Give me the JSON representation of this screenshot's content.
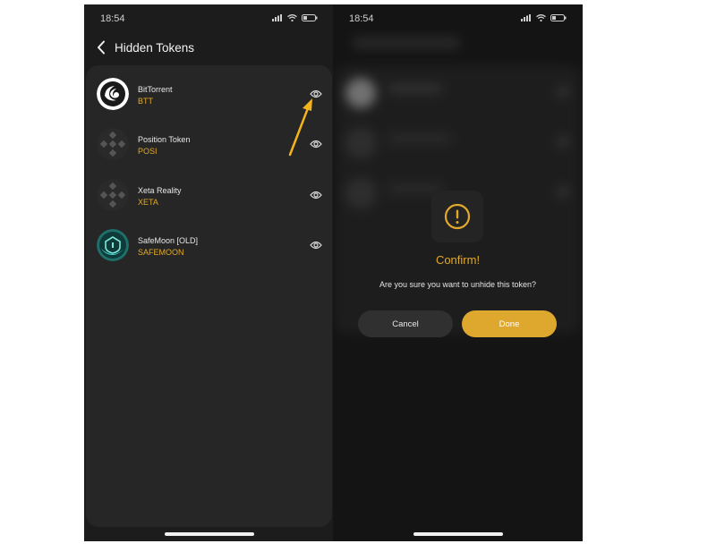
{
  "status": {
    "time": "18:54"
  },
  "header": {
    "title": "Hidden Tokens"
  },
  "tokens": [
    {
      "name": "BitTorrent",
      "symbol": "BTT",
      "logo": "bittorrent-logo"
    },
    {
      "name": "Position Token",
      "symbol": "POSI",
      "logo": "binance-logo"
    },
    {
      "name": "Xeta Reality",
      "symbol": "XETA",
      "logo": "binance-logo"
    },
    {
      "name": "SafeMoon [OLD]",
      "symbol": "SAFEMOON",
      "logo": "safemoon-logo"
    }
  ],
  "dialog": {
    "title": "Confirm!",
    "message": "Are you sure you want to unhide this token?",
    "cancel_label": "Cancel",
    "done_label": "Done"
  },
  "colors": {
    "accent": "#e2a92a",
    "background": "#1c1c1c",
    "card": "#262626",
    "arrow": "#f2b31d"
  },
  "icons": [
    "back-chevron-icon",
    "eye-icon",
    "warning-icon",
    "signal-icon",
    "wifi-icon",
    "battery-icon"
  ]
}
